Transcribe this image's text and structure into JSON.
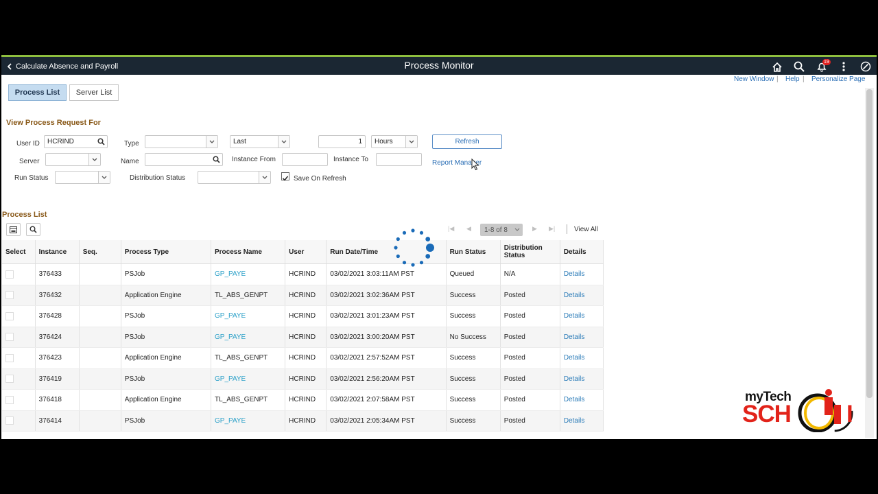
{
  "header": {
    "back_label": "Calculate Absence and Payroll",
    "title": "Process Monitor",
    "notification_count": "19",
    "icons": [
      "home-icon",
      "search-icon",
      "bell-icon",
      "more-vertical-icon",
      "navbar-compass-icon"
    ]
  },
  "top_links": {
    "new_window": "New Window",
    "help": "Help",
    "personalize": "Personalize Page",
    "sep": "|"
  },
  "tabs": [
    {
      "label": "Process List",
      "active": true
    },
    {
      "label": "Server List",
      "active": false
    }
  ],
  "filter": {
    "section_title": "View Process Request For",
    "user_id_label": "User ID",
    "user_id_value": "HCRIND",
    "type_label": "Type",
    "type_value": "",
    "range_value": "Last",
    "count_value": "1",
    "unit_value": "Hours",
    "refresh_label": "Refresh",
    "server_label": "Server",
    "server_value": "",
    "name_label": "Name",
    "name_value": "",
    "instance_from_label": "Instance From",
    "instance_from_value": "",
    "instance_to_label": "Instance To",
    "instance_to_value": "",
    "report_manager_label": "Report Manager",
    "run_status_label": "Run Status",
    "run_status_value": "",
    "distribution_status_label": "Distribution Status",
    "distribution_status_value": "",
    "save_on_refresh_label": "Save On Refresh",
    "save_on_refresh_checked": true
  },
  "grid": {
    "section_title": "Process List",
    "pager": "1-8 of 8",
    "view_all": "View All",
    "columns": [
      "Select",
      "Instance",
      "Seq.",
      "Process Type",
      "Process Name",
      "User",
      "Run Date/Time",
      "Run Status",
      "Distribution Status",
      "Details"
    ],
    "rows": [
      {
        "instance": "376433",
        "seq": "",
        "process_type": "PSJob",
        "process_name": "GP_PAYE",
        "user": "HCRIND",
        "run_datetime": "03/02/2021 3:03:11AM PST",
        "run_status": "Queued",
        "distribution_status": "N/A",
        "details": "Details"
      },
      {
        "instance": "376432",
        "seq": "",
        "process_type": "Application Engine",
        "process_name": "TL_ABS_GENPT",
        "user": "HCRIND",
        "run_datetime": "03/02/2021 3:02:36AM PST",
        "run_status": "Success",
        "distribution_status": "Posted",
        "details": "Details"
      },
      {
        "instance": "376428",
        "seq": "",
        "process_type": "PSJob",
        "process_name": "GP_PAYE",
        "user": "HCRIND",
        "run_datetime": "03/02/2021 3:01:23AM PST",
        "run_status": "Success",
        "distribution_status": "Posted",
        "details": "Details"
      },
      {
        "instance": "376424",
        "seq": "",
        "process_type": "PSJob",
        "process_name": "GP_PAYE",
        "user": "HCRIND",
        "run_datetime": "03/02/2021 3:00:20AM PST",
        "run_status": "No Success",
        "distribution_status": "Posted",
        "details": "Details"
      },
      {
        "instance": "376423",
        "seq": "",
        "process_type": "Application Engine",
        "process_name": "TL_ABS_GENPT",
        "user": "HCRIND",
        "run_datetime": "03/02/2021 2:57:52AM PST",
        "run_status": "Success",
        "distribution_status": "Posted",
        "details": "Details"
      },
      {
        "instance": "376419",
        "seq": "",
        "process_type": "PSJob",
        "process_name": "GP_PAYE",
        "user": "HCRIND",
        "run_datetime": "03/02/2021 2:56:20AM PST",
        "run_status": "Success",
        "distribution_status": "Posted",
        "details": "Details"
      },
      {
        "instance": "376418",
        "seq": "",
        "process_type": "Application Engine",
        "process_name": "TL_ABS_GENPT",
        "user": "HCRIND",
        "run_datetime": "03/02/2021 2:07:58AM PST",
        "run_status": "Success",
        "distribution_status": "Posted",
        "details": "Details"
      },
      {
        "instance": "376414",
        "seq": "",
        "process_type": "PSJob",
        "process_name": "GP_PAYE",
        "user": "HCRIND",
        "run_datetime": "03/02/2021 2:05:34AM PST",
        "run_status": "Success",
        "distribution_status": "Posted",
        "details": "Details"
      }
    ]
  },
  "watermark": {
    "line1": "myTech",
    "line2": "SCH",
    "line3": "I"
  },
  "colors": {
    "banner": "#1b2733",
    "link": "#2a6eb5",
    "section_title": "#8a5a1a",
    "spinner": "#1a6bb8",
    "logo_red": "#e2231a"
  }
}
